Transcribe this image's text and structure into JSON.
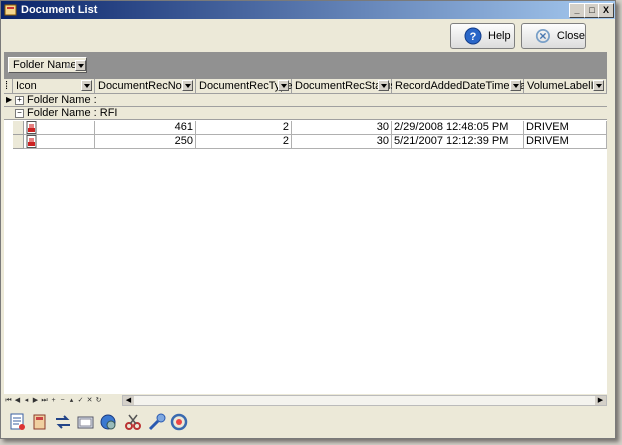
{
  "window": {
    "title": "Document List"
  },
  "titlebar_buttons": {
    "minimize": "_",
    "maximize": "□",
    "close": "X"
  },
  "toolbar": {
    "help_label": "Help",
    "close_label": "Close"
  },
  "groupbar": {
    "chip_label": "Folder Name"
  },
  "columns": [
    "Icon",
    "DocumentRecNo",
    "DocumentRecType",
    "DocumentRecStatus",
    "RecordAddedDateTimeStamp",
    "VolumeLabelID"
  ],
  "groups": [
    {
      "label": "Folder Name :",
      "expander": "+"
    },
    {
      "label": "Folder Name : RFI",
      "expander": "−"
    }
  ],
  "rows": [
    {
      "rec_no": "461",
      "rec_type": "2",
      "rec_status": "30",
      "added": "2/29/2008 12:48:05 PM",
      "volume": "DRIVEM"
    },
    {
      "rec_no": "250",
      "rec_type": "2",
      "rec_status": "30",
      "added": "5/21/2007 12:12:39 PM",
      "volume": "DRIVEM"
    }
  ],
  "icons": {
    "window": "app-icon",
    "help": "help-icon",
    "close": "close-circle-icon",
    "bottom_tools": [
      "report-icon",
      "document-open-icon",
      "arrows-swap-icon",
      "folder-icon",
      "globe-gear-icon",
      "scissors-icon",
      "paint-icon",
      "refresh-icon"
    ]
  },
  "colors": {
    "titlebar_start": "#0a246a",
    "titlebar_end": "#a6caf0",
    "group_panel": "#919191"
  }
}
